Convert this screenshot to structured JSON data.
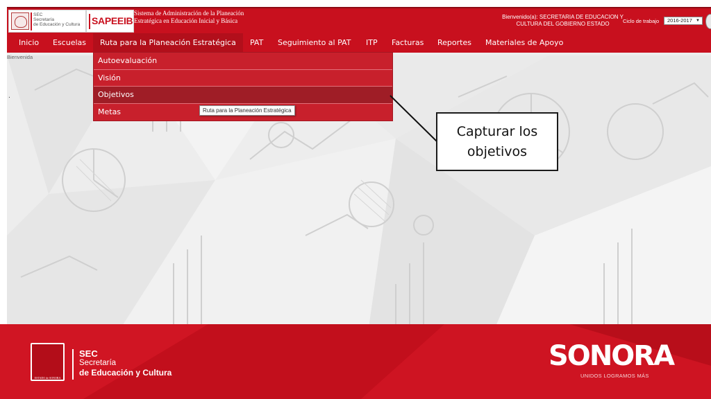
{
  "header": {
    "sec_logo_text": "SEC\nSecretaría\nde Educación y Cultura",
    "sapeeib_logo": "SAPEEIB",
    "system_title": "Sistema de Administración de la Planeación\nEstratégica en Educación Inicial y Básica",
    "welcome": "Bienvenido(a): SECRETARIA DE EDUCACION Y\nCULTURA DEL GOBIERNO ESTADO",
    "cycle_label": "Ciclo de trabajo",
    "cycle_value": "2016-2017"
  },
  "nav": {
    "items": [
      {
        "label": "Inicio"
      },
      {
        "label": "Escuelas"
      },
      {
        "label": "Ruta para la Planeación Estratégica"
      },
      {
        "label": "PAT"
      },
      {
        "label": "Seguimiento al PAT"
      },
      {
        "label": "ITP"
      },
      {
        "label": "Facturas"
      },
      {
        "label": "Reportes"
      },
      {
        "label": "Materiales de Apoyo"
      }
    ]
  },
  "breadcrumb": "Bienvenida",
  "stray_dot": ".",
  "dropdown": {
    "items": [
      {
        "label": "Autoevaluación"
      },
      {
        "label": "Visión"
      },
      {
        "label": "Objetivos"
      },
      {
        "label": "Metas"
      }
    ],
    "tooltip": "Ruta para la Planeación Estratégica"
  },
  "callout": {
    "text": "Capturar los objetivos"
  },
  "footer": {
    "sec_l1": "SEC",
    "sec_l2": "Secretaría",
    "sec_l3": "de Educación y Cultura",
    "crest_label": "ESTADO de SONORA",
    "sonora": "SONORA",
    "tagline": "UNIDOS LOGRAMOS MÁS"
  },
  "colors": {
    "brand_red": "#c8101e",
    "menu_red": "#c8202c",
    "menu_hover": "#9f1d26",
    "background": "#ededed"
  }
}
